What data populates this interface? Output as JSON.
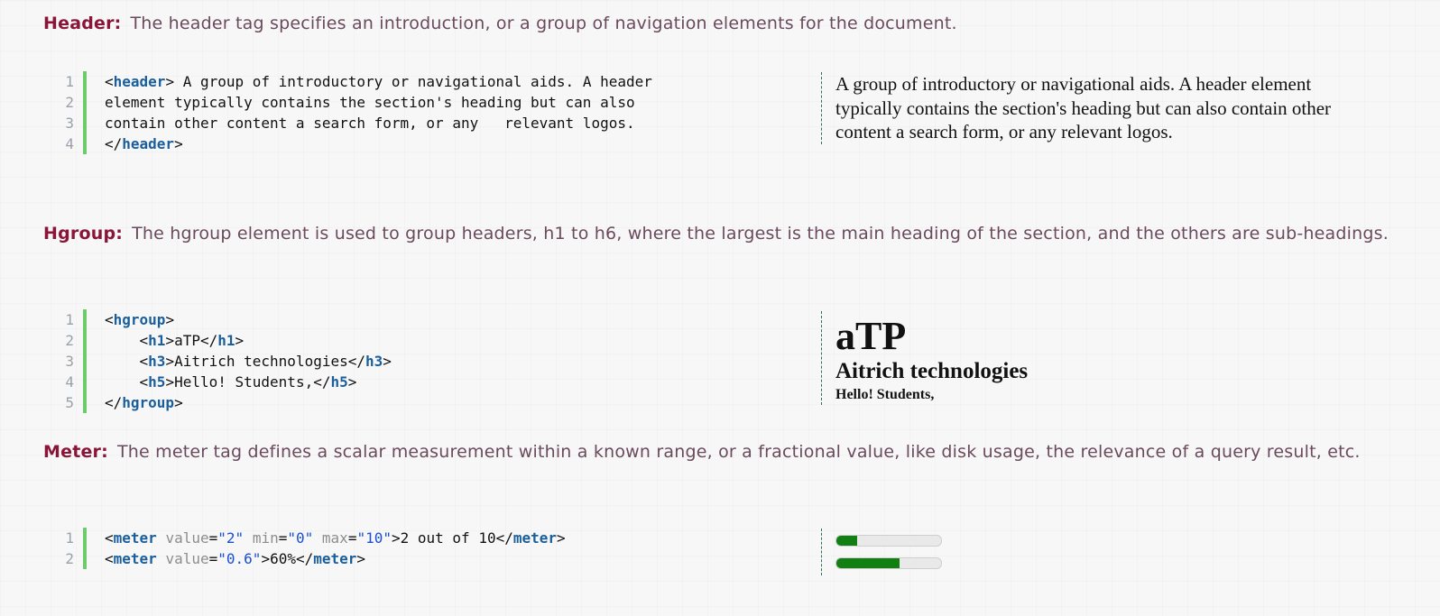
{
  "header_section": {
    "tag": "Header:",
    "description": "The header tag specifies an introduction, or a group of navigation elements for the document.",
    "line_numbers": [
      "1",
      "2",
      "3",
      "4"
    ],
    "code": {
      "l1_open": "<",
      "l1_tag": "header",
      "l1_close": ">",
      "l1_text": " A group of introductory or navigational aids. A header",
      "l2": "element typically contains the section's heading but can also",
      "l3": "contain other content a search form, or any   relevant logos.",
      "l4_open": "</",
      "l4_tag": "header",
      "l4_close": ">"
    },
    "preview_text": "A group of introductory or navigational aids. A header element typically contains the section's heading but can also contain other content a search form, or any relevant logos."
  },
  "hgroup_section": {
    "tag": "Hgroup:",
    "description": "The hgroup element is used to group headers, h1 to h6, where the largest is the main heading of the section, and the others are sub-headings.",
    "line_numbers": [
      "1",
      "2",
      "3",
      "4",
      "5"
    ],
    "code": {
      "hgroup_tag": "hgroup",
      "h1_tag": "h1",
      "h1_text": "aTP",
      "h3_tag": "h3",
      "h3_text": "Aitrich technologies",
      "h5_tag": "h5",
      "h5_text": "Hello! Students,"
    },
    "preview": {
      "h1": "aTP",
      "h3": "Aitrich technologies",
      "h5": "Hello! Students,"
    }
  },
  "meter_section": {
    "tag": "Meter:",
    "description": "The meter tag defines a scalar measurement within a known range, or a fractional value, like disk usage, the relevance of a query result, etc.",
    "line_numbers": [
      "1",
      "2"
    ],
    "code": {
      "meter_tag": "meter",
      "attr_value": "value",
      "attr_min": "min",
      "attr_max": "max",
      "m1_value": "\"2\"",
      "m1_min": "\"0\"",
      "m1_max": "\"10\"",
      "m1_text": "2 out of 10",
      "m2_value": "\"0.6\"",
      "m2_text": "60%"
    },
    "meters": [
      {
        "fraction": 0.2
      },
      {
        "fraction": 0.6
      }
    ],
    "meter_color": "#117f11"
  },
  "colors": {
    "tag_color": "#8a1538",
    "keyword_color": "#1a5f9c",
    "string_color": "#1a4fd6",
    "gutter_bar": "#6ccc6c"
  }
}
